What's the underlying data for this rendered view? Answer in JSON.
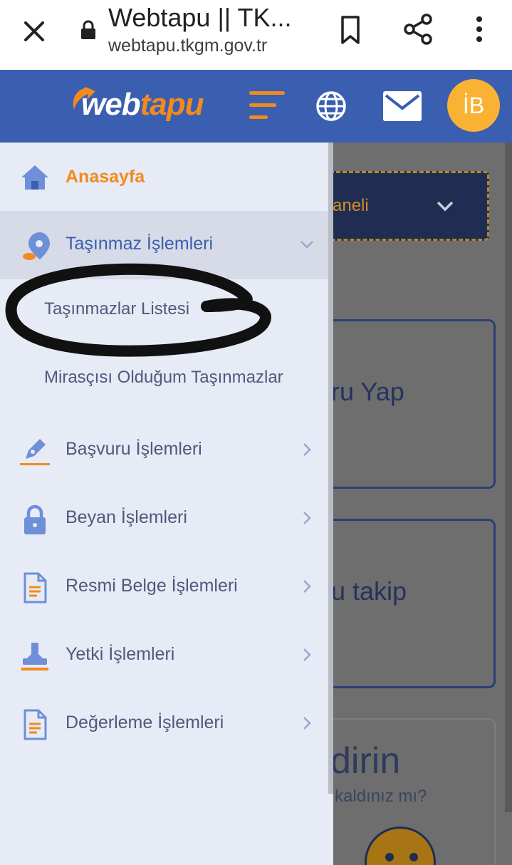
{
  "browser": {
    "title": "Webtapu || TK...",
    "url": "webtapu.tkgm.gov.tr",
    "icons": [
      "close-icon",
      "lock-icon",
      "bookmark-icon",
      "share-icon",
      "more-vert-icon"
    ]
  },
  "header": {
    "logo_prefix": "web",
    "logo_accent": "tapu",
    "avatar_initials": "İB",
    "icons": [
      "menu-icon",
      "globe-icon",
      "mail-icon"
    ],
    "colors": {
      "bar": "#3a5fb0",
      "accent": "#f28a1e",
      "avatar": "#f9b233"
    }
  },
  "drawer": {
    "items": [
      {
        "label": "Anasayfa",
        "icon": "home-icon",
        "state": "current"
      },
      {
        "label": "Taşınmaz İşlemleri",
        "icon": "map-pin-icon",
        "state": "expanded"
      },
      {
        "label": "Başvuru İşlemleri",
        "icon": "pen-icon"
      },
      {
        "label": "Beyan İşlemleri",
        "icon": "lock-icon"
      },
      {
        "label": "Resmi Belge İşlemleri",
        "icon": "document-icon"
      },
      {
        "label": "Yetki İşlemleri",
        "icon": "stamp-icon"
      },
      {
        "label": "Değerleme İşlemleri",
        "icon": "document-icon"
      }
    ],
    "subitems": [
      {
        "label": "Taşınmazlar Listesi",
        "highlighted": true
      },
      {
        "label": "Mirasçısı Olduğum Taşınmazlar"
      }
    ]
  },
  "background_page": {
    "dropdown_fragment": "Paneli",
    "card_fragment_1": "ru Yap",
    "card_fragment_2": "u takip",
    "card_fragment_3": "dirin",
    "card_fragment_3_sub": "n kaldınız mı?"
  }
}
